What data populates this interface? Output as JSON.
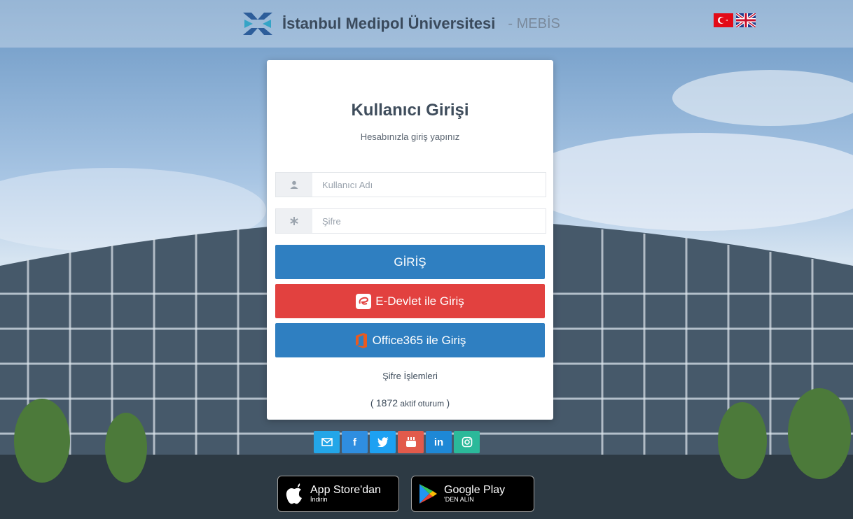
{
  "header": {
    "brand_name": "İstanbul Medipol Üniversitesi",
    "brand_suffix": "- MEBİS",
    "logo_icon": "medipol-logo-icon",
    "languages": [
      "tr-flag-icon",
      "en-flag-icon"
    ]
  },
  "login": {
    "title": "Kullanıcı Girişi",
    "subtitle": "Hesabınızla giriş yapınız",
    "username": {
      "placeholder": "Kullanıcı Adı",
      "value": "",
      "icon": "user-icon"
    },
    "password": {
      "placeholder": "Şifre",
      "value": "",
      "icon": "asterisk-icon"
    },
    "login_button": "GİRİŞ",
    "edevlet_button": "E-Devlet ile Giriş",
    "office_button": "Office365 ile Giriş",
    "password_ops_link": "Şifre İşlemleri",
    "sessions": {
      "open": "(",
      "count": "1872",
      "label": "aktif oturum",
      "close": ")"
    }
  },
  "social": {
    "items": [
      {
        "name": "mail",
        "icon": "mail-icon",
        "color": "#23a6e8"
      },
      {
        "name": "facebook",
        "icon": "facebook-icon",
        "label": "f",
        "color": "#2f8ee0"
      },
      {
        "name": "twitter",
        "icon": "twitter-icon",
        "color": "#1da1f2"
      },
      {
        "name": "youtube",
        "icon": "youtube-icon",
        "color": "#e25a4b"
      },
      {
        "name": "linkedin",
        "icon": "linkedin-icon",
        "label": "in",
        "color": "#1e88d6"
      },
      {
        "name": "instagram",
        "icon": "instagram-icon",
        "color": "#2bb99a"
      }
    ]
  },
  "stores": {
    "apple": {
      "line1": "App Store'dan",
      "line2": "İndirin"
    },
    "google": {
      "line1": "Google Play",
      "line2": "'DEN ALIN"
    }
  },
  "colors": {
    "primary": "#2f7fc1",
    "edevlet": "#e2413f",
    "title_text": "#3f4d5c"
  }
}
